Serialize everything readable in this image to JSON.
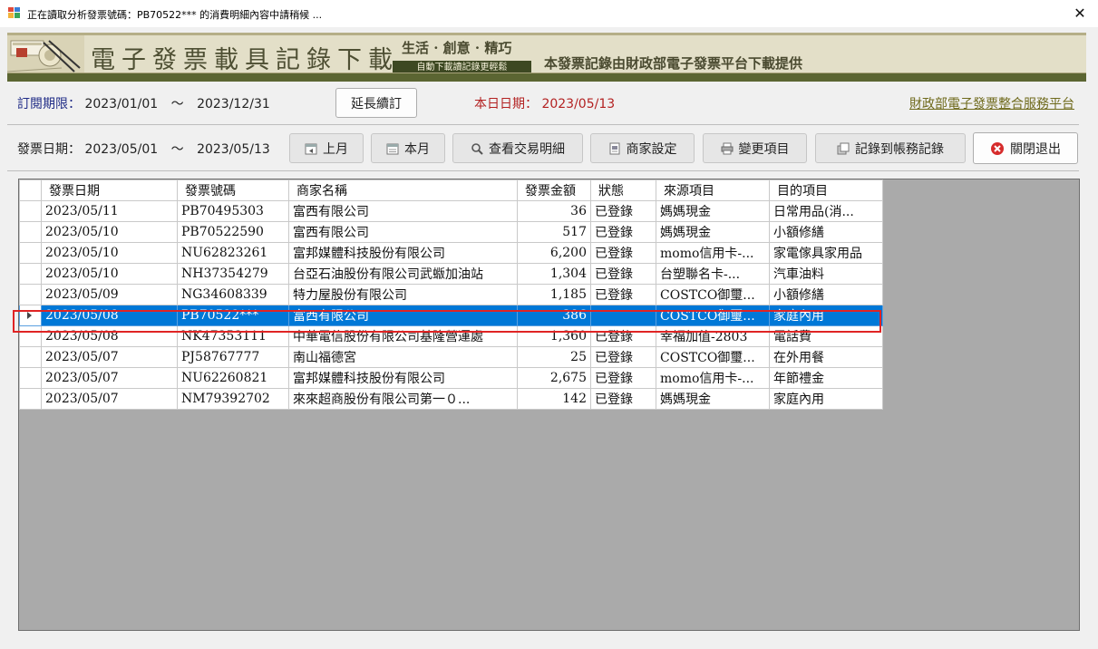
{
  "window": {
    "title": "正在讀取分析發票號碼：PB70522*** 的消費明細內容中請稍候 ...",
    "close_glyph": "✕"
  },
  "banner": {
    "title": "電子發票載具記錄下載",
    "slogan": "生活 · 創意 · 精巧",
    "tag": "自動下載讀記錄更輕鬆",
    "provider": "本發票記錄由財政部電子發票平台下載提供"
  },
  "subscription": {
    "label": "訂閱期限：",
    "start": "2023/01/01",
    "tilde": "〜",
    "end": "2023/12/31",
    "extend_button": "延長續訂",
    "today_label": "本日日期：",
    "today": "2023/05/13",
    "portal_link": "財政部電子發票整合服務平台"
  },
  "filter": {
    "label": "發票日期：",
    "start": "2023/05/01",
    "tilde": "〜",
    "end": "2023/05/13"
  },
  "toolbar": {
    "prev_month": "上月",
    "this_month": "本月",
    "view_details": "查看交易明細",
    "merchant_settings": "商家設定",
    "change_item": "變更項目",
    "record_to_accounts": "記錄到帳務記錄",
    "close_exit": "關閉退出"
  },
  "icons": {
    "prev_month": "calendar-back-icon",
    "this_month": "calendar-icon",
    "view_details": "magnifier-icon",
    "merchant_settings": "store-settings-icon",
    "change_item": "printer-icon",
    "record_to_accounts": "copy-records-icon",
    "close_exit": "close-circle-icon"
  },
  "colors": {
    "selection": "#0078d7",
    "highlight_border": "#e02424",
    "banner_dark": "#3d4822",
    "label_blue": "#1f2b86",
    "label_red": "#b32222"
  },
  "table": {
    "columns": [
      "發票日期",
      "發票號碼",
      "商家名稱",
      "發票金額",
      "狀態",
      "來源項目",
      "目的項目"
    ],
    "selected_index": 5,
    "rows": [
      [
        "2023/05/11",
        "PB70495303",
        "富西有限公司",
        "36",
        "已登錄",
        "媽媽現金",
        "日常用品(消..."
      ],
      [
        "2023/05/10",
        "PB70522590",
        "富西有限公司",
        "517",
        "已登錄",
        "媽媽現金",
        "小額修繕"
      ],
      [
        "2023/05/10",
        "NU62823261",
        "富邦媒體科技股份有限公司",
        "6,200",
        "已登錄",
        "momo信用卡-...",
        "家電傢具家用品"
      ],
      [
        "2023/05/10",
        "NH37354279",
        "台亞石油股份有限公司武蝂加油站",
        "1,304",
        "已登錄",
        "台塑聯名卡-...",
        "汽車油料"
      ],
      [
        "2023/05/09",
        "NG34608339",
        "特力屋股份有限公司",
        "1,185",
        "已登錄",
        "COSTCO御璽...",
        "小額修繕"
      ],
      [
        "2023/05/08",
        "PB70522***",
        "富西有限公司",
        "386",
        "",
        "COSTCO御璽...",
        "家庭內用"
      ],
      [
        "2023/05/08",
        "NK47353111",
        "中華電信股份有限公司基隆營運處",
        "1,360",
        "已登錄",
        "幸福加值-2803",
        "電話費"
      ],
      [
        "2023/05/07",
        "PJ58767777",
        "南山福德宮",
        "25",
        "已登錄",
        "COSTCO御璽...",
        "在外用餐"
      ],
      [
        "2023/05/07",
        "NU62260821",
        "富邦媒體科技股份有限公司",
        "2,675",
        "已登錄",
        "momo信用卡-...",
        "年節禮金"
      ],
      [
        "2023/05/07",
        "NM79392702",
        "來來超商股份有限公司第一０...",
        "142",
        "已登錄",
        "媽媽現金",
        "家庭內用"
      ]
    ]
  }
}
